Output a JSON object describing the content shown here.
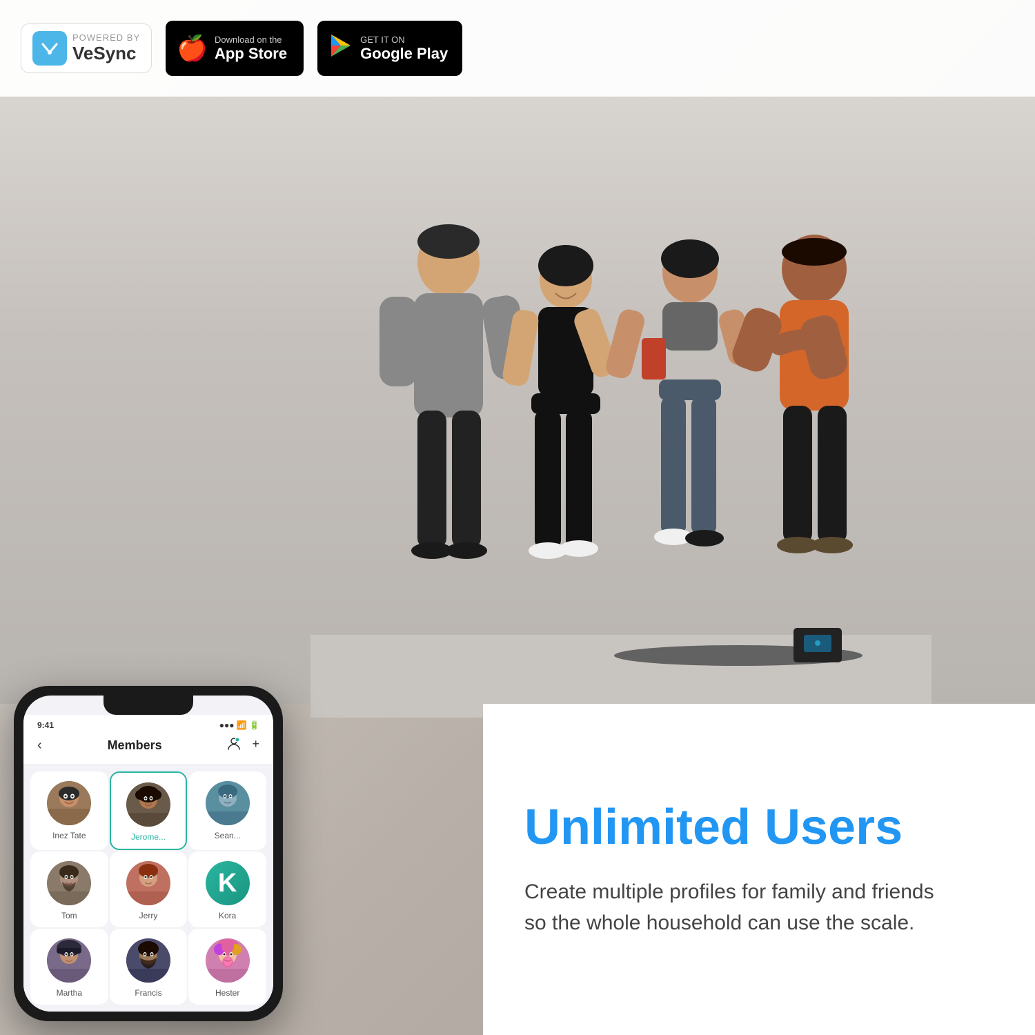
{
  "header": {
    "vesync": {
      "powered_by": "POWERED BY",
      "brand": "VeSync",
      "icon": "🏠"
    },
    "app_store": {
      "download_label": "Download on the",
      "store_name": "App Store",
      "icon": "🍎"
    },
    "google_play": {
      "get_it_on": "GET IT ON",
      "store_name": "Google Play",
      "icon": "▶"
    }
  },
  "phone": {
    "screen_title": "Members",
    "back_icon": "‹",
    "person_icon": "👤",
    "add_icon": "+",
    "members": [
      {
        "name": "Inez Tate",
        "avatar_class": "avatar-inez",
        "selected": false,
        "letter": ""
      },
      {
        "name": "Jerome...",
        "avatar_class": "avatar-jerome",
        "selected": true,
        "letter": ""
      },
      {
        "name": "Sean...",
        "avatar_class": "avatar-sean",
        "letter": ""
      },
      {
        "name": "Tom",
        "avatar_class": "avatar-tom",
        "letter": ""
      },
      {
        "name": "Jerry",
        "avatar_class": "avatar-jerry",
        "letter": ""
      },
      {
        "name": "Kora",
        "avatar_class": "avatar-kora",
        "letter": "K"
      },
      {
        "name": "Martha",
        "avatar_class": "avatar-martha",
        "letter": ""
      },
      {
        "name": "Francis",
        "avatar_class": "avatar-francis",
        "letter": ""
      },
      {
        "name": "Hester",
        "avatar_class": "avatar-hester",
        "letter": ""
      }
    ]
  },
  "bottom": {
    "title": "Unlimited Users",
    "description": "Create multiple profiles for family and friends\nso the whole household can use the scale."
  }
}
